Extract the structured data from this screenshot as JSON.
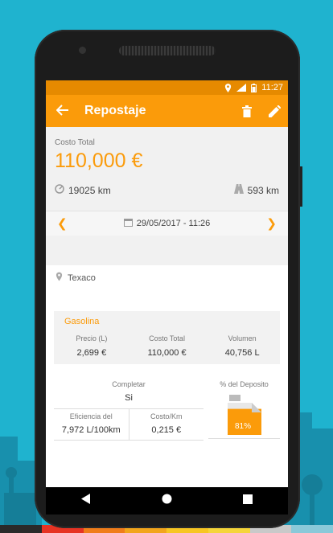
{
  "status": {
    "time": "11:27"
  },
  "appbar": {
    "title": "Repostaje"
  },
  "summary": {
    "cost_label": "Costo Total",
    "cost_value": "110,000 €",
    "odometer": "19025 km",
    "distance": "593 km"
  },
  "datebar": {
    "date": "29/05/2017 - 11:26"
  },
  "station": {
    "name": "Texaco"
  },
  "fuel": {
    "name": "Gasolina",
    "columns": [
      {
        "label": "Precio (L)",
        "value": "2,699 €"
      },
      {
        "label": "Costo Total",
        "value": "110,000 €"
      },
      {
        "label": "Volumen",
        "value": "40,756 L"
      }
    ]
  },
  "stats": {
    "complete_label": "Completar",
    "complete_value": "Si",
    "efficiency_label": "Eficiencia del",
    "efficiency_value": "7,972 L/100km",
    "costkm_label": "Costo/Km",
    "costkm_value": "0,215 €",
    "tank_label": "% del Deposito",
    "tank_value": "81%",
    "tank_fraction": 0.81
  },
  "colors": {
    "accent": "#fb9b0a",
    "statusbar": "#e68a00",
    "background": "#1fb3cf"
  }
}
